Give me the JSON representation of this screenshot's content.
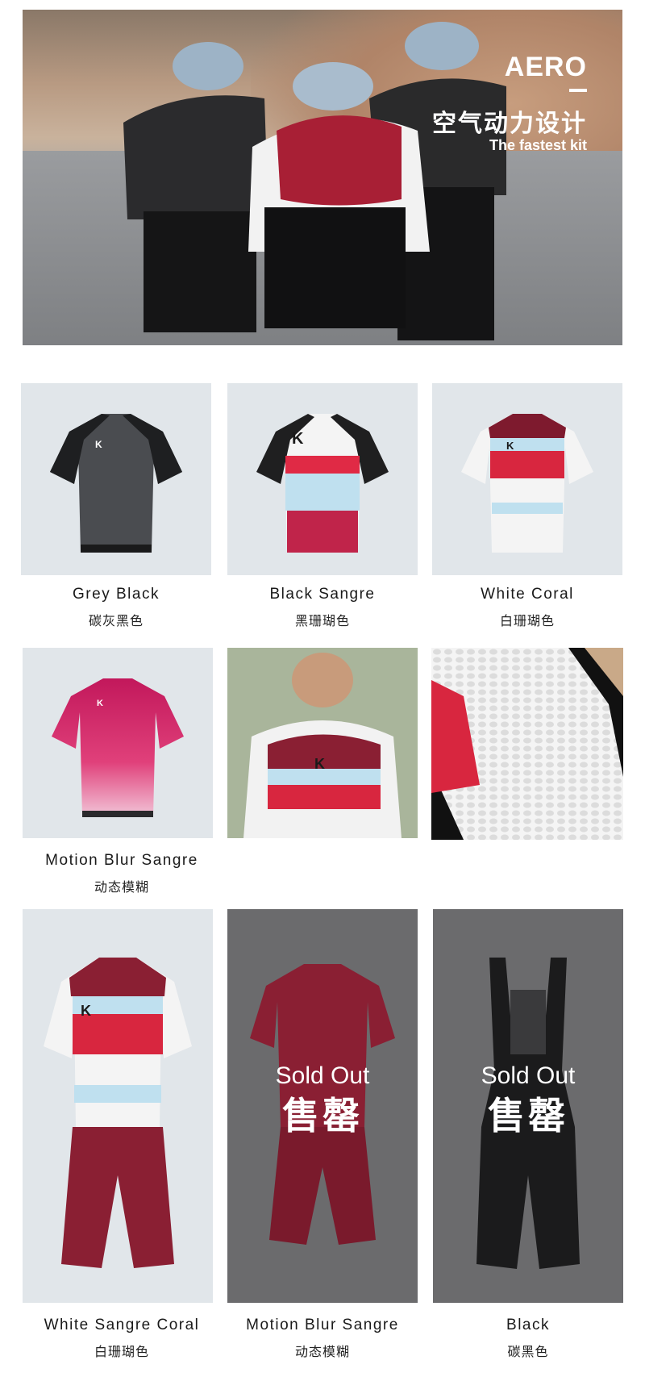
{
  "hero": {
    "title": "AERO",
    "subtitle": "空气动力设计",
    "tagline": "The fastest kit"
  },
  "products_row1": [
    {
      "name_en": "Grey Black",
      "name_zh": "碳灰黑色"
    },
    {
      "name_en": "Black Sangre",
      "name_zh": "黑珊瑚色"
    },
    {
      "name_en": "White Coral",
      "name_zh": "白珊瑚色"
    }
  ],
  "products_row2": [
    {
      "name_en": "Motion Blur Sangre",
      "name_zh": "动态模糊"
    }
  ],
  "products_row3": [
    {
      "name_en": "White Sangre Coral",
      "name_zh": "白珊瑚色"
    },
    {
      "name_en": "Motion Blur Sangre",
      "name_zh": "动态模糊",
      "sold_en": "Sold Out",
      "sold_zh": "售罄"
    },
    {
      "name_en": "Black",
      "name_zh": "碳黑色",
      "sold_en": "Sold Out",
      "sold_zh": "售罄"
    }
  ],
  "colors": {
    "tile_light": "#e1e6ea",
    "tile_dark": "#6b6b6d",
    "sangre": "#8a1f33",
    "coral": "#d8263f",
    "sky": "#bfe0ef"
  }
}
